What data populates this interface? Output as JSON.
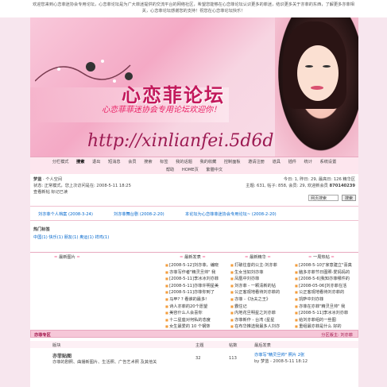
{
  "welcome": {
    "line1": "欢迎您来到心恋菲迷协会专用论坛，心恋菲论坛是为广大菲迷提供的交流平台的网络社区，希望您能够在心恋菲论坛认识更多的菲迷，结识更多关于亦菲的东西，了解更多亦菲相",
    "line2": "关，心恋菲论坛感谢您的支持！祝您在心恋菲论坛快乐！"
  },
  "banner": {
    "title": "心恋菲论坛",
    "subtitle": "心恋菲菲迷协会专用论坛欢迎你！",
    "url": "http://xinlianfei.5d6d.com/"
  },
  "nav": {
    "row1": [
      "分栏模式",
      "搜索",
      "退出",
      "短消息",
      "会员",
      "搜索",
      "标签",
      "我的话题",
      "我的收藏",
      "控制面板",
      "邀请注册",
      "道具",
      "插件",
      "统计",
      "系统设置"
    ],
    "row2": [
      "帮助",
      "HOME页",
      "繁體中文"
    ]
  },
  "userpanel": {
    "name": "梦蓝",
    "space": "· 个人空间",
    "status": "状态: 正常模式，您上次访问是在: 2008-5-11 18:25",
    "links": "查看新帖 标记已读",
    "today": "今日: 1, 昨日: 29, 最高日: 126  精华区",
    "stats_prefix": "主题: 631, 帖子: 858, 会员: 29, 欢迎新会员",
    "stats_member": "870140239",
    "search_option": "网页搜索",
    "search_button": "搜索"
  },
  "news": {
    "items": [
      "刘亦菲个人档案 (2008-3-24)",
      "刘亦菲舞台剧 (2008-2-20)",
      "本论坛为心恋菲菲迷协会专用论坛~ (2008-2-20)"
    ]
  },
  "hot": {
    "title": "热门标签",
    "tags": "中国(1)  快乐(1)  朋友(1)  奥运(1)  祥鸡(1)"
  },
  "columns": {
    "headers": [
      "最新图片",
      "最新发表",
      "最新精华",
      "一周热帖"
    ],
    "newest": [
      "[2008-5-12]刘亦菲，编晓",
      "亦菲写作者\"精灵旦帅\" 我",
      "[2008-5-11]李冰冰刘亦菲",
      "[2008-5-11]亦菲许明星美",
      "[2008-5-11]亦菲你到了",
      "马甲? ? 看谁的最多!",
      "诗人亦菲的20个愿望",
      "美容什么人会喜你",
      "十二星座对何私的态度",
      "女生最爱的 10 个钢饰"
    ],
    "essence": [
      "打破往昔的公主-刘亦菲",
      "生女当如刘亦菲",
      "凤凰中刘亦菲",
      "刘亦菲 - 一颗清新的钻",
      "公正客观地看待刘亦菲的",
      "亦菲 -《功夫之王》",
      "霸住记",
      "内地花旦明星之刘亦菲",
      "亦菲新作 - 台湾 (星星",
      "在布华推选我最多人刘亦"
    ],
    "week": [
      "[2008-5-10]\"家意建立\"喜真",
      "脑多亦菲节日图照-爱妈妈的",
      "[2008-5-6]我知亦菲哪件的",
      "[2008-05-06]刘亦菲在活",
      "公正客观地看待刘亦菲的",
      "凯萨中刘亦菲",
      "亦菲在亦菲\"精灵旦帅\" 我",
      "[2008-5-11]李冰冰刘亦菲",
      "给刘亦菲组的一些图",
      "重组最亦菲是什么 好的"
    ]
  },
  "forum": {
    "section": "亦菲专区",
    "moderator": "分区版主: 刘亦菲",
    "col_forum": "版块",
    "col_topics": "主题",
    "col_posts": "帖数",
    "col_last": "最后发表",
    "name": "亦菲贴图",
    "desc": "亦菲的剧照、曲播新图片、生活照、广告艺术照 及其他关",
    "topics": "32",
    "posts": "113",
    "last_title": "亦菲写\"精灵旦帅\" 照片 2张",
    "last_meta": "by 梦蓝 - 2008-5-11 18:12"
  }
}
